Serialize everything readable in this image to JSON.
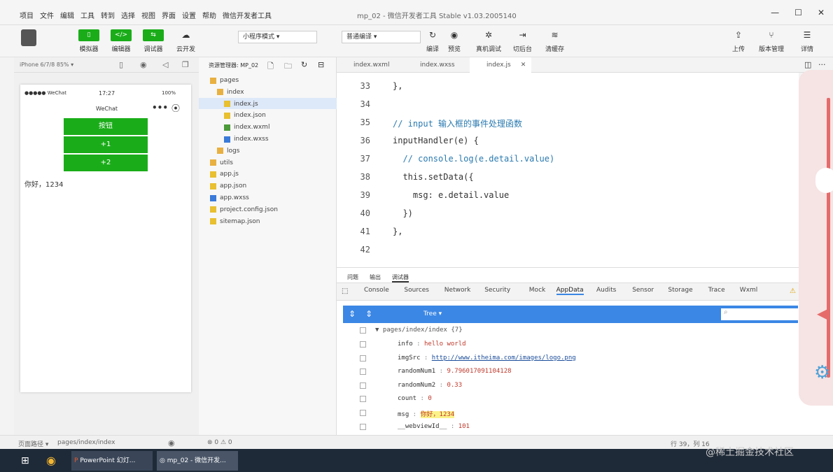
{
  "menubar": {
    "items": [
      "项目",
      "文件",
      "编辑",
      "工具",
      "转到",
      "选择",
      "视图",
      "界面",
      "设置",
      "帮助",
      "微信开发者工具"
    ],
    "title": "mp_02 - 微信开发者工具 Stable v1.03.2005140",
    "min": "—",
    "max": "☐",
    "close": "✕"
  },
  "toolbar": {
    "simulator": "模拟器",
    "editor": "编辑器",
    "debugger": "调试器",
    "cloud": "云开发",
    "mode": "小程序模式",
    "compile_mode": "普通编译",
    "compile": "编译",
    "preview": "预览",
    "real_debug": "真机调试",
    "backend": "切后台",
    "clear_cache": "清缓存",
    "upload": "上传",
    "version": "版本管理",
    "details": "详情"
  },
  "sim": {
    "device": "iPhone 6/7/8 85% ▾",
    "carrier": "●●●●● WeChat",
    "time": "17:27",
    "battery": "100%",
    "nav_title": "WeChat",
    "btn1": "按钮",
    "btn2": "+1",
    "btn3": "+2",
    "text": "你好，1234"
  },
  "explorer": {
    "header": "资源管理器: MP_02",
    "items": [
      {
        "label": "pages",
        "depth": 0
      },
      {
        "label": "index",
        "depth": 1
      },
      {
        "label": "index.js",
        "depth": 2
      },
      {
        "label": "index.json",
        "depth": 2
      },
      {
        "label": "index.wxml",
        "depth": 2
      },
      {
        "label": "index.wxss",
        "depth": 2
      },
      {
        "label": "logs",
        "depth": 1
      },
      {
        "label": "utils",
        "depth": 0
      },
      {
        "label": "app.js",
        "depth": 0
      },
      {
        "label": "app.json",
        "depth": 0
      },
      {
        "label": "app.wxss",
        "depth": 0
      },
      {
        "label": "project.config.json",
        "depth": 0
      },
      {
        "label": "sitemap.json",
        "depth": 0
      }
    ]
  },
  "tabs": [
    "index.wxml",
    "index.wxss",
    "index.js"
  ],
  "code": [
    {
      "n": "33",
      "t": "},"
    },
    {
      "n": "34",
      "t": ""
    },
    {
      "n": "35",
      "t": "// input 输入框的事件处理函数"
    },
    {
      "n": "36",
      "t": "inputHandler(e) {"
    },
    {
      "n": "37",
      "t": "  // console.log(e.detail.value)"
    },
    {
      "n": "38",
      "t": "  this.setData({"
    },
    {
      "n": "39",
      "t": "    msg: e.detail.value"
    },
    {
      "n": "40",
      "t": "  })"
    },
    {
      "n": "41",
      "t": "},"
    },
    {
      "n": "42",
      "t": ""
    }
  ],
  "devtools": {
    "top_tabs": [
      "问题",
      "输出",
      "调试器"
    ],
    "tabs": [
      "Console",
      "Sources",
      "Network",
      "Security",
      "Mock",
      "AppData",
      "Audits",
      "Sensor",
      "Storage",
      "Trace",
      "Wxml"
    ],
    "view": "Tree ▾",
    "root": "pages/index/index {7}",
    "rows": [
      {
        "k": "info",
        "v": "hello world"
      },
      {
        "k": "imgSrc",
        "v": "http://www.itheima.com/images/logo.png"
      },
      {
        "k": "randomNum1",
        "v": "9.796017091104128"
      },
      {
        "k": "randomNum2",
        "v": "0.33"
      },
      {
        "k": "count",
        "v": "0"
      },
      {
        "k": "msg",
        "v": "你好，1234"
      },
      {
        "k": "__webviewId__",
        "v": "101"
      }
    ]
  },
  "status": {
    "path_label": "页面路径 ▾",
    "path": "pages/index/index",
    "errors": "⊗ 0 ⚠ 0",
    "pos": "行 39，列 16"
  },
  "taskbar": {
    "ppt": "PowerPoint 幻灯...",
    "app": "mp_02 - 微信开发..."
  },
  "watermark": "@稀土掘金技术社区"
}
